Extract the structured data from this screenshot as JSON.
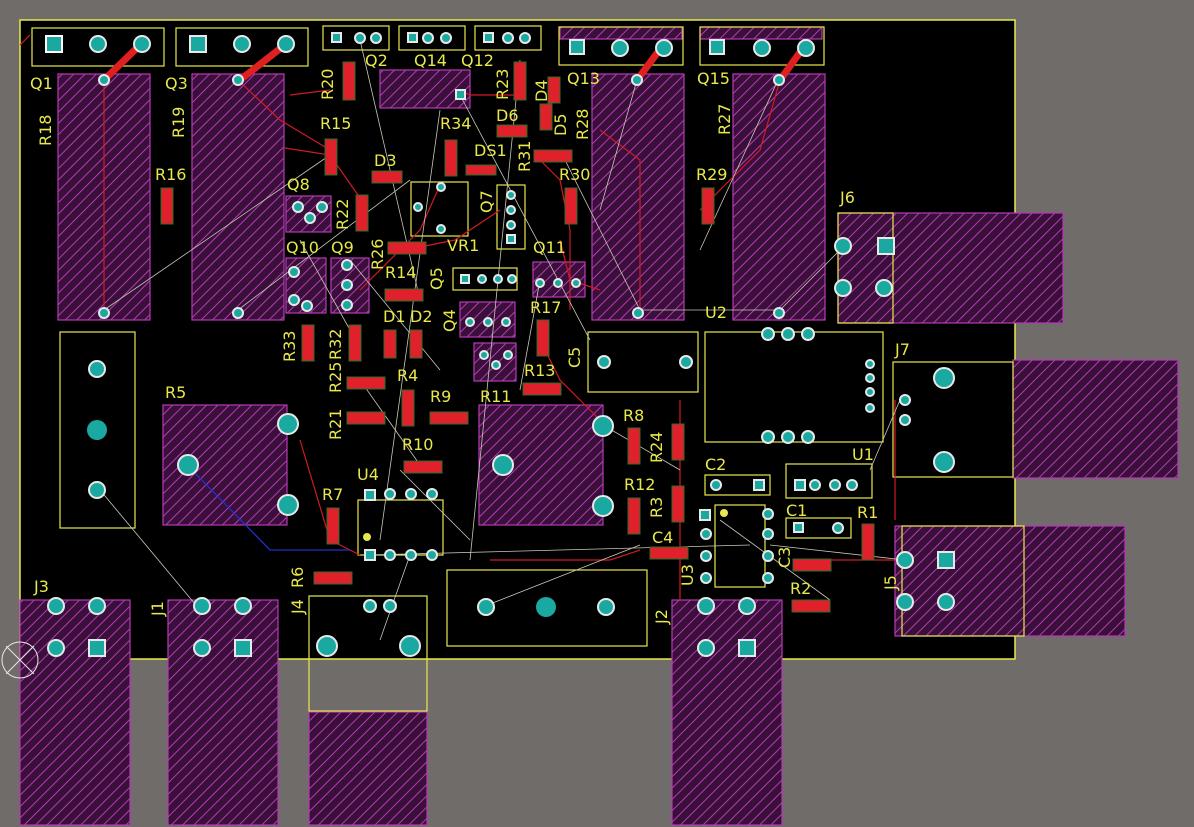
{
  "app": {
    "view": "PCB Editor - 2D layout"
  },
  "colors": {
    "background": "#6f6c69",
    "board": "#000000",
    "outline": "#e8e84a",
    "silk": "#e8e84a",
    "pad": "#e0202a",
    "via": "#1aa9a0",
    "hatch": "#b43bb4",
    "trace_top": "#d01b24",
    "ratsnest": "#c8c8b8",
    "trace_bottom": "#2030c8"
  },
  "designators": [
    "Q1",
    "Q3",
    "R20",
    "Q2",
    "Q14",
    "Q12",
    "R23",
    "D4",
    "Q13",
    "Q15",
    "R18",
    "R19",
    "R15",
    "R34",
    "D6",
    "D5",
    "R28",
    "R27",
    "R16",
    "D3",
    "DS1",
    "R31",
    "R30",
    "R29",
    "Q8",
    "R22",
    "R26",
    "Q7",
    "J6",
    "Q10",
    "Q9",
    "VR1",
    "Q11",
    "R14",
    "Q5",
    "U2",
    "R33",
    "R32",
    "D1",
    "D2",
    "Q4",
    "R17",
    "J7",
    "R25",
    "C5",
    "R4",
    "R9",
    "R11",
    "R13",
    "R21",
    "R5",
    "R8",
    "R24",
    "R10",
    "C2",
    "U1",
    "U4",
    "R7",
    "R12",
    "R3",
    "C1",
    "R1",
    "C4",
    "C3",
    "R2",
    "J3",
    "J1",
    "J4",
    "R6",
    "J2",
    "U3",
    "J5"
  ]
}
